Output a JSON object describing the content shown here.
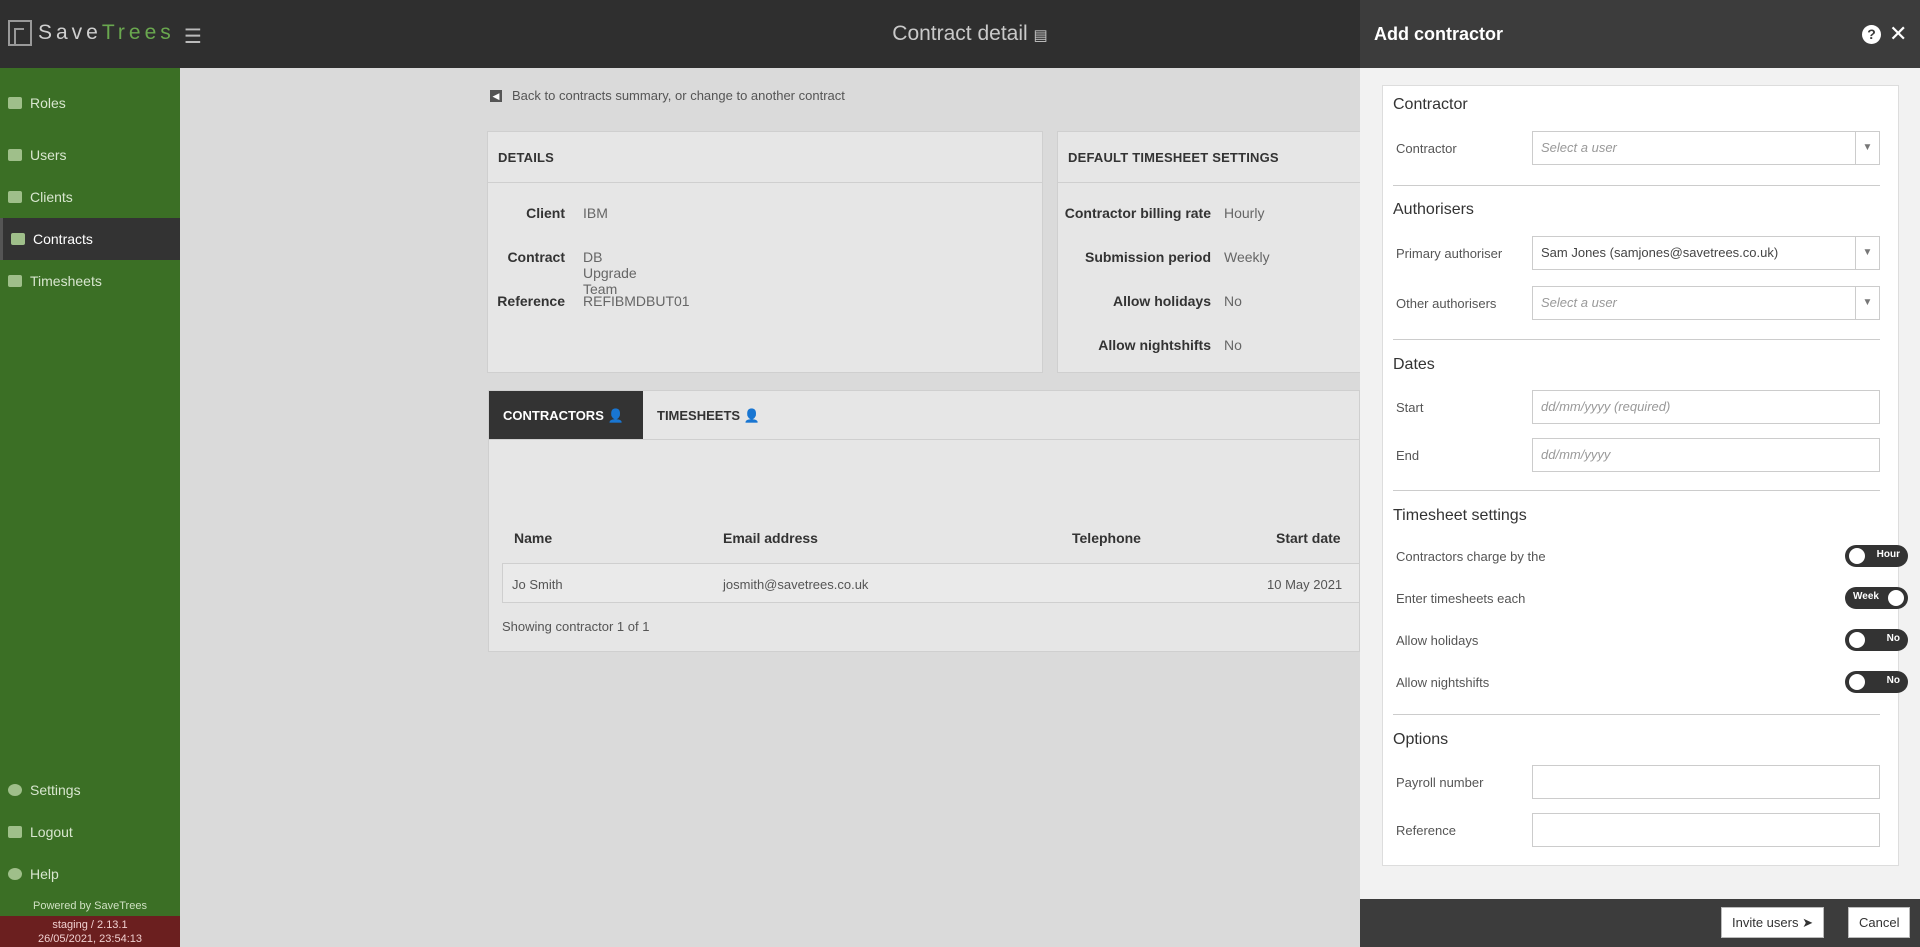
{
  "app": {
    "logo_a": "Save",
    "logo_b": "Trees",
    "page_title": "Contract detail"
  },
  "sidebar": {
    "items": [
      {
        "label": "Roles",
        "icon": "id-card-icon"
      },
      {
        "label": "Users",
        "icon": "user-card-icon"
      },
      {
        "label": "Clients",
        "icon": "building-icon"
      },
      {
        "label": "Contracts",
        "icon": "document-icon"
      },
      {
        "label": "Timesheets",
        "icon": "user-clock-icon"
      }
    ],
    "bottom": [
      {
        "label": "Settings",
        "icon": "gear-icon"
      },
      {
        "label": "Logout",
        "icon": "logout-icon"
      },
      {
        "label": "Help",
        "icon": "help-icon"
      }
    ],
    "powered_by": "Powered by SaveTrees",
    "env": "staging / 2.13.1",
    "timestamp": "26/05/2021, 23:54:13"
  },
  "main": {
    "back_link": "Back to contracts summary, or change to another contract",
    "details": {
      "title": "DETAILS",
      "rows": [
        {
          "k": "Client",
          "v": "IBM"
        },
        {
          "k": "Contract",
          "v": "DB Upgrade Team"
        },
        {
          "k": "Reference",
          "v": "REFIBMDBUT01"
        }
      ]
    },
    "defaults": {
      "title": "DEFAULT TIMESHEET SETTINGS",
      "rows": [
        {
          "k": "Contractor billing rate",
          "v": "Hourly"
        },
        {
          "k": "Submission period",
          "v": "Weekly"
        },
        {
          "k": "Allow holidays",
          "v": "No"
        },
        {
          "k": "Allow nightshifts",
          "v": "No"
        }
      ]
    },
    "tabs": [
      {
        "label": "CONTRACTORS"
      },
      {
        "label": "TIMESHEETS"
      }
    ],
    "table": {
      "headers": [
        "Name",
        "Email address",
        "Telephone",
        "Start date"
      ],
      "rows": [
        {
          "name": "Jo Smith",
          "email": "josmith@savetrees.co.uk",
          "telephone": "",
          "start": "10 May 2021"
        }
      ],
      "showing": "Showing contractor 1 of 1"
    }
  },
  "panel": {
    "title": "Add contractor",
    "contractor_section": "Contractor",
    "contractor_label": "Contractor",
    "contractor_placeholder": "Select a user",
    "authorisers_section": "Authorisers",
    "primary_label": "Primary authoriser",
    "primary_value": "Sam Jones (samjones@savetrees.co.uk)",
    "other_label": "Other authorisers",
    "other_placeholder": "Select a user",
    "dates_section": "Dates",
    "start_label": "Start",
    "start_placeholder": "dd/mm/yyyy (required)",
    "end_label": "End",
    "end_placeholder": "dd/mm/yyyy",
    "timesheet_section": "Timesheet settings",
    "toggles": [
      {
        "label": "Contractors charge by the",
        "value": "Hour"
      },
      {
        "label": "Enter timesheets each",
        "value": "Week"
      },
      {
        "label": "Allow holidays",
        "value": "No"
      },
      {
        "label": "Allow nightshifts",
        "value": "No"
      }
    ],
    "options_section": "Options",
    "payroll_label": "Payroll number",
    "reference_label": "Reference",
    "invite_button": "Invite users",
    "cancel_button": "Cancel"
  }
}
